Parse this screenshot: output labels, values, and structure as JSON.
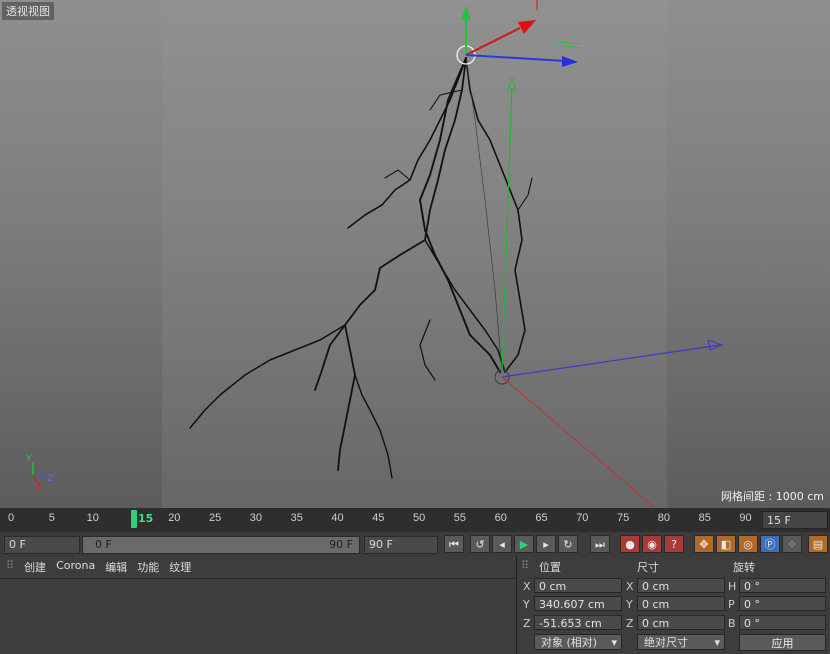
{
  "viewport": {
    "title": "透视视图",
    "grid_info": "网格间距 : 1000 cm"
  },
  "timeline": {
    "ticks": [
      "0",
      "5",
      "10",
      "15",
      "20",
      "25",
      "30",
      "35",
      "40",
      "45",
      "50",
      "55",
      "60",
      "65",
      "70",
      "75",
      "80",
      "85",
      "90"
    ],
    "current_frame": "15",
    "frame_field": "15 F"
  },
  "transport": {
    "start": "0 F",
    "range_start": "0 F",
    "range_end": "90 F",
    "end": "90 F"
  },
  "objects": {
    "menu": [
      "创建",
      "Corona",
      "编辑",
      "功能",
      "纹理"
    ]
  },
  "attributes": {
    "headers": {
      "position": "位置",
      "size": "尺寸",
      "rotation": "旋转"
    },
    "axes": [
      "X",
      "Y",
      "Z"
    ],
    "rot_axes": [
      "H",
      "P",
      "B"
    ],
    "position": [
      "0 cm",
      "340.607 cm",
      "-51.653 cm"
    ],
    "size": [
      "0 cm",
      "0 cm",
      "0 cm"
    ],
    "rotation": [
      "0 °",
      "0 °",
      "0 °"
    ],
    "mode": "对象 (相对)",
    "size_mode": "绝对尺寸",
    "apply": "应用"
  }
}
